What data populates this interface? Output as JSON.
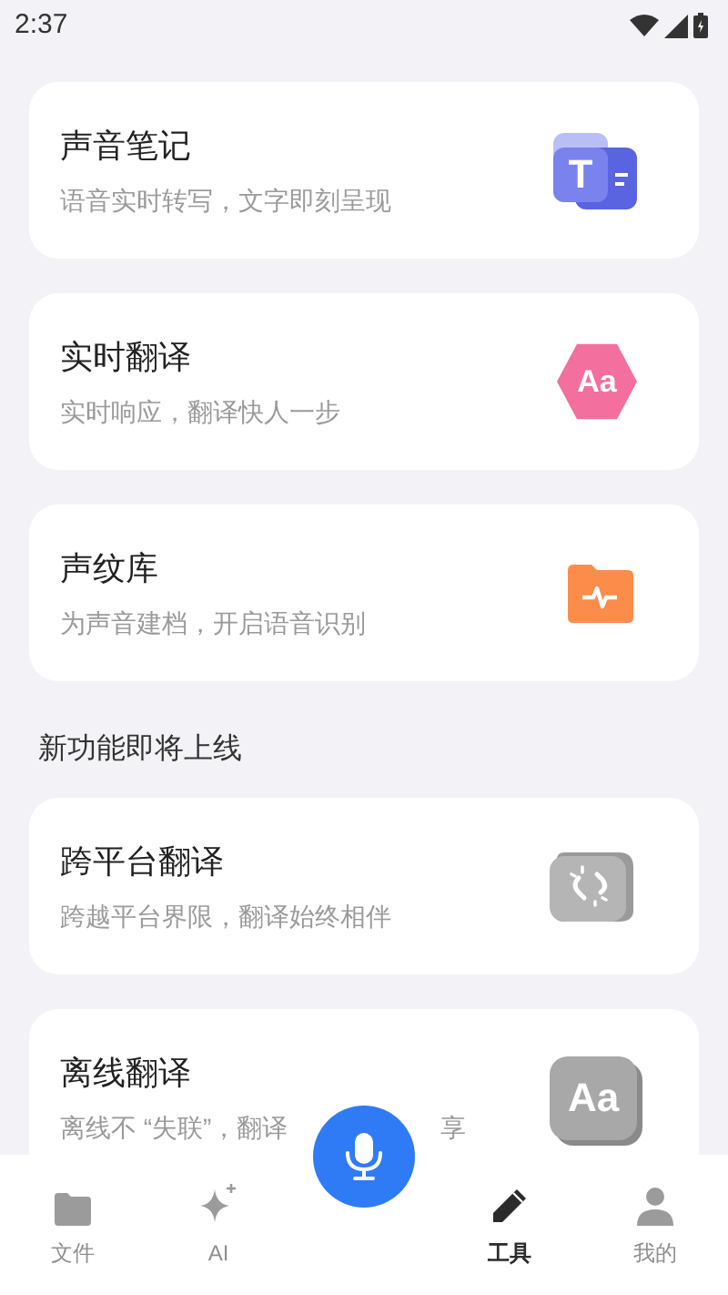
{
  "status_bar": {
    "time": "2:37"
  },
  "cards": [
    {
      "title": "声音笔记",
      "subtitle": [
        "语音实时转写，文字即刻呈现"
      ],
      "glyph": "T"
    },
    {
      "title": "实时翻译",
      "subtitle": [
        "实时响应，翻译快人一步"
      ],
      "glyph": "Aa"
    },
    {
      "title": "声纹库",
      "subtitle": [
        "为声音建档，开启语音识别"
      ]
    }
  ],
  "section_title": "新功能即将上线",
  "upcoming": [
    {
      "title": "跨平台翻译",
      "subtitle": [
        "跨越平台界限，翻译始终相伴"
      ]
    },
    {
      "title": "离线翻译",
      "subtitle": [
        "离线不 “失联”，翻译",
        "享"
      ],
      "glyph": "Aa"
    }
  ],
  "tab_bar": [
    {
      "kind": "tab",
      "label": "文件",
      "selected": false
    },
    {
      "kind": "tab",
      "label": "AI",
      "selected": false
    },
    {
      "kind": "mic"
    },
    {
      "kind": "tab",
      "label": "工具",
      "selected": true
    },
    {
      "kind": "tab",
      "label": "我的",
      "selected": false
    }
  ]
}
